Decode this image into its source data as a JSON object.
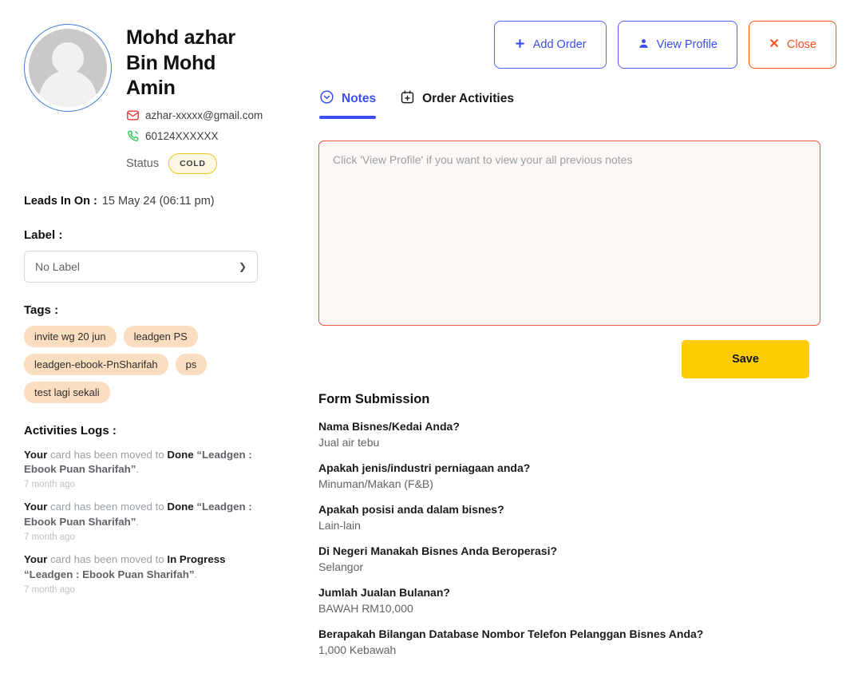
{
  "profile": {
    "avatar_icon": "user-avatar-placeholder-icon",
    "name": "Mohd azhar Bin Mohd Amin",
    "email": "azhar-xxxxx@gmail.com",
    "email_icon": "envelope-icon",
    "phone": "60124XXXXXX",
    "phone_icon": "phone-icon",
    "status_label": "Status",
    "status_value": "COLD",
    "leads_in_on_label": "Leads In On :",
    "leads_in_on_value": "15 May 24 (06:11 pm)"
  },
  "label_section": {
    "title": "Label :",
    "selected": "No Label",
    "chevron_icon": "chevron-down-icon"
  },
  "tags_section": {
    "title": "Tags :",
    "tags": [
      "invite wg 20 jun",
      "leadgen PS",
      "leadgen-ebook-PnSharifah",
      "ps",
      "test lagi sekali"
    ]
  },
  "activities_logs": {
    "title": "Activities Logs :",
    "items": [
      {
        "actor": "Your",
        "middle": " card has been moved to ",
        "target": "Done",
        "quoted": " “Leadgen : Ebook Puan Sharifah”",
        "period": ".",
        "time": "7 month ago"
      },
      {
        "actor": "Your",
        "middle": " card has been moved to ",
        "target": "Done",
        "quoted": " “Leadgen : Ebook Puan Sharifah”",
        "period": ".",
        "time": "7 month ago"
      },
      {
        "actor": "Your",
        "middle": " card has been moved to ",
        "target": "In Progress",
        "quoted": " “Leadgen : Ebook Puan Sharifah”",
        "period": ".",
        "time": "7 month ago"
      }
    ]
  },
  "actions": {
    "add_order": {
      "label": "Add Order",
      "icon": "plus-icon",
      "glyph": "✚"
    },
    "view_profile": {
      "label": "View Profile",
      "icon": "person-icon",
      "glyph": "👤"
    },
    "close": {
      "label": "Close",
      "icon": "close-x-icon",
      "glyph": "✖"
    }
  },
  "tabs": [
    {
      "label": "Notes",
      "icon": "check-circle-icon",
      "active": true
    },
    {
      "label": "Order Activities",
      "icon": "calendar-plus-icon",
      "active": false
    }
  ],
  "notes": {
    "placeholder": "Click 'View Profile' if you want to view your all previous notes",
    "value": "",
    "save_label": "Save"
  },
  "form_submission": {
    "title": "Form Submission",
    "items": [
      {
        "question": "Nama Bisnes/Kedai Anda?",
        "answer": "Jual air tebu"
      },
      {
        "question": "Apakah jenis/industri perniagaan anda?",
        "answer": "Minuman/Makan (F&B)"
      },
      {
        "question": "Apakah posisi anda dalam bisnes?",
        "answer": "Lain-lain"
      },
      {
        "question": "Di Negeri Manakah Bisnes Anda Beroperasi?",
        "answer": "Selangor"
      },
      {
        "question": "Jumlah Jualan Bulanan?",
        "answer": "BAWAH RM10,000"
      },
      {
        "question": "Berapakah Bilangan Database Nombor Telefon Pelanggan Bisnes Anda?",
        "answer": "1,000 Kebawah"
      }
    ]
  },
  "colors": {
    "accent_blue": "#3b4ef0",
    "close_red": "#f4511e",
    "save_yellow": "#fdcc05",
    "tag_bg": "#fbddbf",
    "status_border": "#f0c419",
    "note_border": "#e5533a",
    "email_icon": "#e53935",
    "phone_icon": "#34c759"
  }
}
